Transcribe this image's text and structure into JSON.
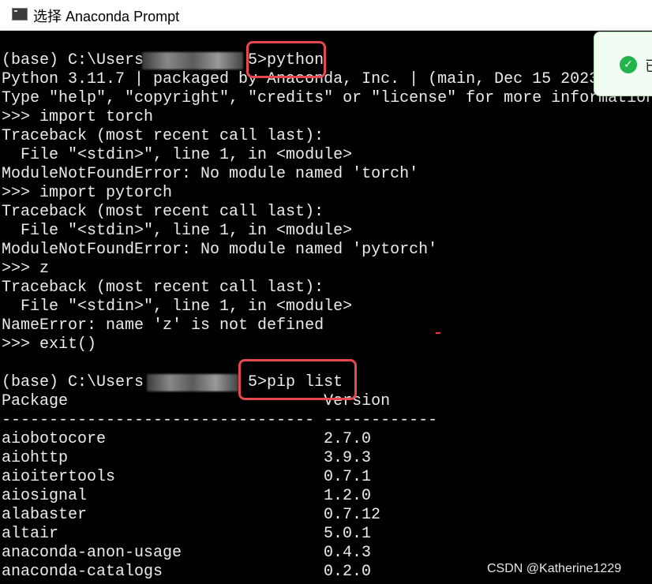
{
  "window": {
    "title": "选择 Anaconda Prompt",
    "icon": "console-icon"
  },
  "terminal": {
    "lines": [
      "(base) C:\\Users           5>python",
      "Python 3.11.7 | packaged by Anaconda, Inc. | (main, Dec 15 2023",
      "Type \"help\", \"copyright\", \"credits\" or \"license\" for more information",
      ">>> import torch",
      "Traceback (most recent call last):",
      "  File \"<stdin>\", line 1, in <module>",
      "ModuleNotFoundError: No module named 'torch'",
      ">>> import pytorch",
      "Traceback (most recent call last):",
      "  File \"<stdin>\", line 1, in <module>",
      "ModuleNotFoundError: No module named 'pytorch'",
      ">>> z",
      "Traceback (most recent call last):",
      "  File \"<stdin>\", line 1, in <module>",
      "NameError: name 'z' is not defined",
      ">>> exit()",
      "",
      "(base) C:\\Users           5>pip list",
      "Package                           Version",
      "--------------------------------- ------------"
    ],
    "packages": [
      {
        "name": "aiobotocore",
        "version": "2.7.0"
      },
      {
        "name": "aiohttp",
        "version": "3.9.3"
      },
      {
        "name": "aioitertools",
        "version": "0.7.1"
      },
      {
        "name": "aiosignal",
        "version": "1.2.0"
      },
      {
        "name": "alabaster",
        "version": "0.7.12"
      },
      {
        "name": "altair",
        "version": "5.0.1"
      },
      {
        "name": "anaconda-anon-usage",
        "version": "0.4.3"
      },
      {
        "name": "anaconda-catalogs",
        "version": "0.2.0"
      }
    ]
  },
  "toast": {
    "icon": "check-circle-icon",
    "text": "已",
    "color": "#22b34c"
  },
  "watermark": "CSDN @Katherine1229",
  "highlight_color": "#e5484d"
}
